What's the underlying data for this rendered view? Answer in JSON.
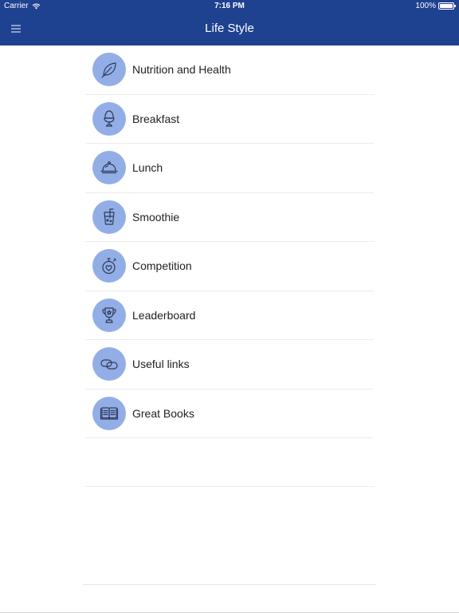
{
  "status_bar": {
    "carrier": "Carrier",
    "time": "7:16 PM",
    "battery": "100%",
    "battery_level": 1.0
  },
  "nav": {
    "title": "Life Style",
    "menu_icon": "hamburger-icon"
  },
  "colors": {
    "nav_background": "#1e4190",
    "icon_circle": "#93aee6",
    "icon_stroke": "#2d3a5c",
    "separator": "#ececec"
  },
  "menu_items": [
    {
      "label": "Nutrition and Health",
      "icon": "leaf-icon"
    },
    {
      "label": "Breakfast",
      "icon": "egg-cup-icon"
    },
    {
      "label": "Lunch",
      "icon": "cloche-icon"
    },
    {
      "label": "Smoothie",
      "icon": "drink-glass-icon"
    },
    {
      "label": "Competition",
      "icon": "stopwatch-heart-icon"
    },
    {
      "label": "Leaderboard",
      "icon": "trophy-icon"
    },
    {
      "label": "Useful links",
      "icon": "link-icon"
    },
    {
      "label": "Great Books",
      "icon": "open-book-icon"
    }
  ]
}
